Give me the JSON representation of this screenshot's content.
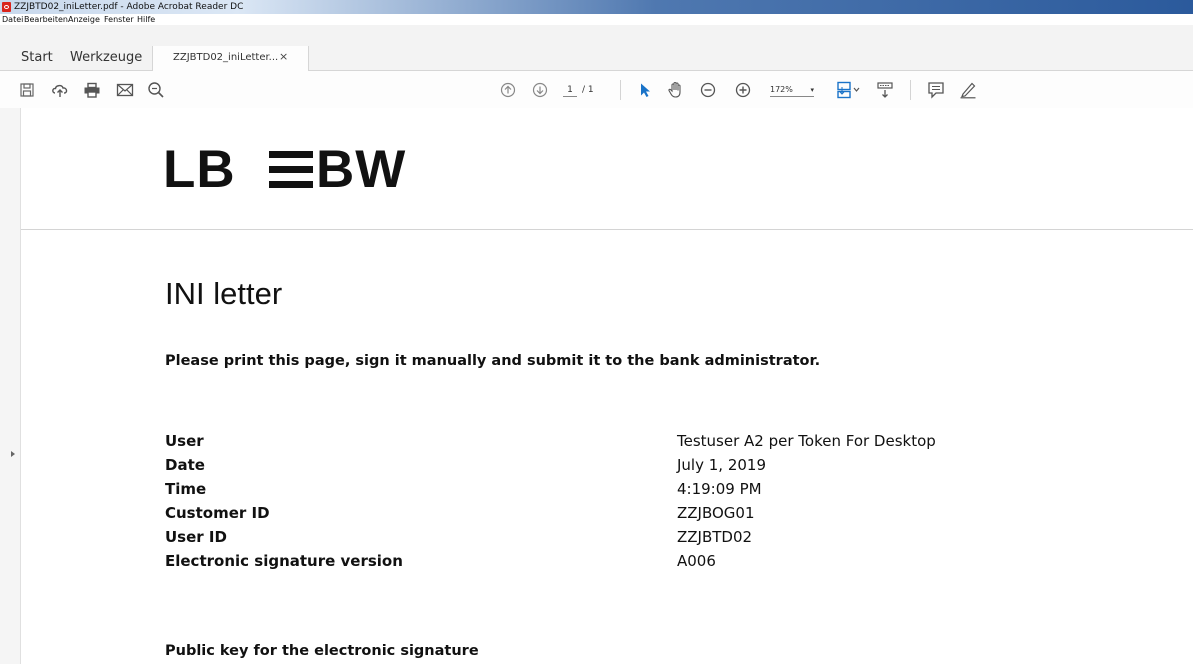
{
  "window": {
    "title": "ZZJBTD02_iniLetter.pdf - Adobe Acrobat Reader DC"
  },
  "menu": {
    "items": [
      "Datei",
      "Bearbeiten",
      "Anzeige",
      "Fenster",
      "Hilfe"
    ]
  },
  "tabs": {
    "start": "Start",
    "tools": "Werkzeuge",
    "document": "ZZJBTD02_iniLetter...",
    "close": "×"
  },
  "toolbar": {
    "page_current": "1",
    "page_total": "/ 1",
    "zoom": "172%",
    "zoom_caret": "▾",
    "icons": [
      "save-icon",
      "cloud-upload-icon",
      "print-icon",
      "email-icon",
      "search-zoom-icon",
      "page-up-icon",
      "page-down-icon",
      "select-arrow-icon",
      "hand-icon",
      "zoom-out-icon",
      "zoom-in-icon",
      "page-layout-icon",
      "scroll-mode-icon",
      "comment-icon",
      "highlight-pen-icon"
    ]
  },
  "document": {
    "logo": {
      "left": "LB",
      "right": "BW"
    },
    "heading": "INI letter",
    "instruction": "Please print this page, sign it manually and submit it to the bank administrator.",
    "fields": [
      {
        "label": "User",
        "value": "Testuser A2 per Token For Desktop"
      },
      {
        "label": "Date",
        "value": "July 1, 2019"
      },
      {
        "label": "Time",
        "value": "4:19:09 PM"
      },
      {
        "label": "Customer ID",
        "value": "ZZJBOG01"
      },
      {
        "label": "User ID",
        "value": "ZZJBTD02"
      },
      {
        "label": "Electronic signature version",
        "value": "A006"
      }
    ],
    "pubkey_heading": "Public key for the electronic signature"
  },
  "colors": {
    "accent": "#1a73c8",
    "text": "#111111",
    "titlebar_dark": "#2b5a9c"
  }
}
